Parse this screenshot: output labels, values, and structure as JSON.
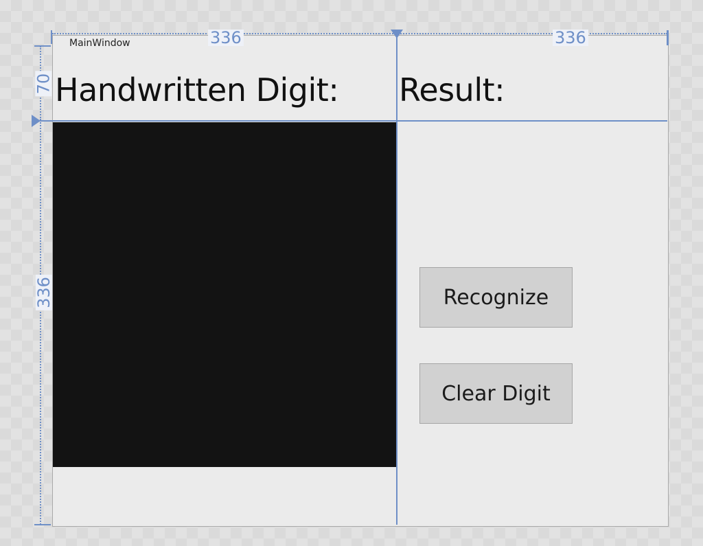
{
  "window": {
    "title": "MainWindow"
  },
  "labels": {
    "input_heading": "Handwritten Digit:",
    "result_heading": "Result:"
  },
  "buttons": {
    "recognize": "Recognize",
    "clear": "Clear Digit"
  },
  "designer": {
    "column_width_left": "336",
    "column_width_right": "336",
    "row_height_top": "70",
    "row_height_main": "336"
  },
  "colors": {
    "guide": "#6e8fc7",
    "canvas": "#131313",
    "window": "#ebebeb",
    "button": "#d1d1d1"
  }
}
